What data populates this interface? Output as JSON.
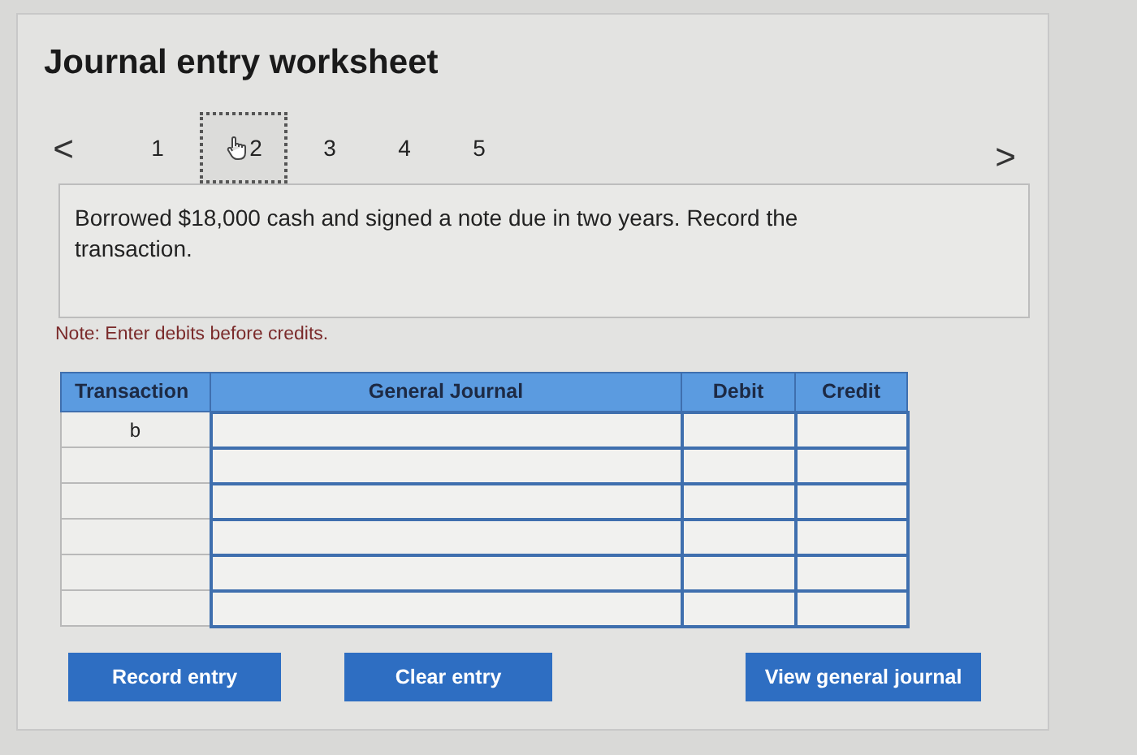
{
  "title": "Journal entry worksheet",
  "nav": {
    "prev": "<",
    "next": ">"
  },
  "tabs": [
    {
      "label": "1",
      "selected": false
    },
    {
      "label": "2",
      "selected": true
    },
    {
      "label": "3",
      "selected": false
    },
    {
      "label": "4",
      "selected": false
    },
    {
      "label": "5",
      "selected": false
    }
  ],
  "prompt": "Borrowed $18,000 cash and signed a note due in two years. Record the transaction.",
  "note": "Note: Enter debits before credits.",
  "table": {
    "columns": [
      "Transaction",
      "General Journal",
      "Debit",
      "Credit"
    ],
    "rows": [
      {
        "transaction": "b"
      },
      {},
      {},
      {},
      {},
      {}
    ]
  },
  "buttons": [
    "Record entry",
    "Clear entry",
    "View general journal"
  ]
}
